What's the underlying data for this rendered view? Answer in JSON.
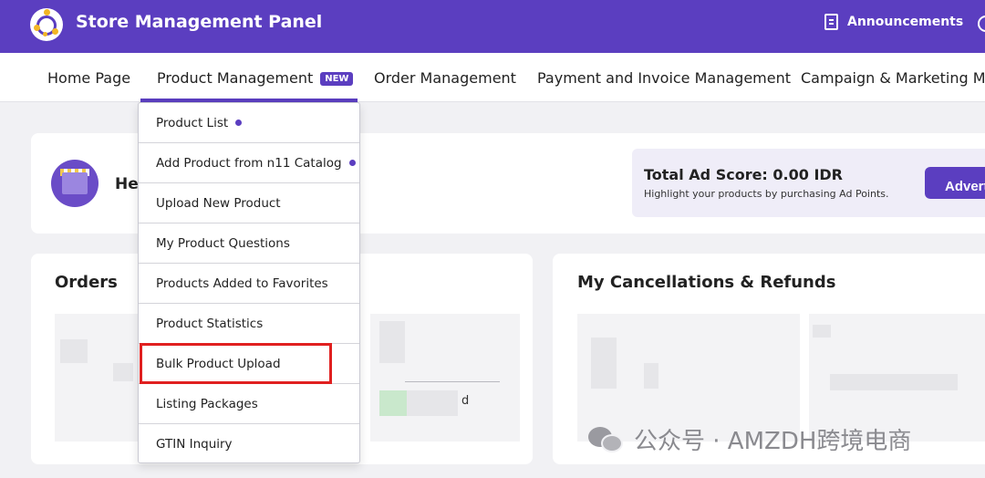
{
  "header": {
    "app_title": "Store Management Panel",
    "announcements_label": "Announcements",
    "brand_color": "#5b3ec0",
    "logo_icon": "store-logo-icon",
    "announcements_icon": "document-icon"
  },
  "nav": {
    "items": [
      {
        "label": "Home Page"
      },
      {
        "label": "Product Management",
        "badge": "NEW",
        "active": true
      },
      {
        "label": "Order Management"
      },
      {
        "label": "Payment and Invoice Management"
      },
      {
        "label": "Campaign & Marketing Man"
      }
    ]
  },
  "dropdown": {
    "items": [
      {
        "label": "Product List",
        "dot": true
      },
      {
        "label": "Add Product from n11 Catalog",
        "dot": true
      },
      {
        "label": "Upload New Product"
      },
      {
        "label": "My Product Questions"
      },
      {
        "label": "Products Added to Favorites"
      },
      {
        "label": "Product Statistics"
      },
      {
        "label": "Bulk Product Upload",
        "highlighted": true
      },
      {
        "label": "Listing Packages"
      },
      {
        "label": "GTIN Inquiry"
      }
    ],
    "highlight_color": "#e02020"
  },
  "welcome": {
    "greeting_partial": "Hel"
  },
  "ad": {
    "score_label": "Total Ad Score: 0.00 IDR",
    "description": "Highlight your products by purchasing Ad Points.",
    "button_label": "Advert"
  },
  "orders": {
    "title": "Orders",
    "partial_text": "d"
  },
  "cancellations": {
    "title": "My Cancellations & Refunds"
  },
  "watermark": {
    "text": "公众号 · AMZDH跨境电商"
  }
}
